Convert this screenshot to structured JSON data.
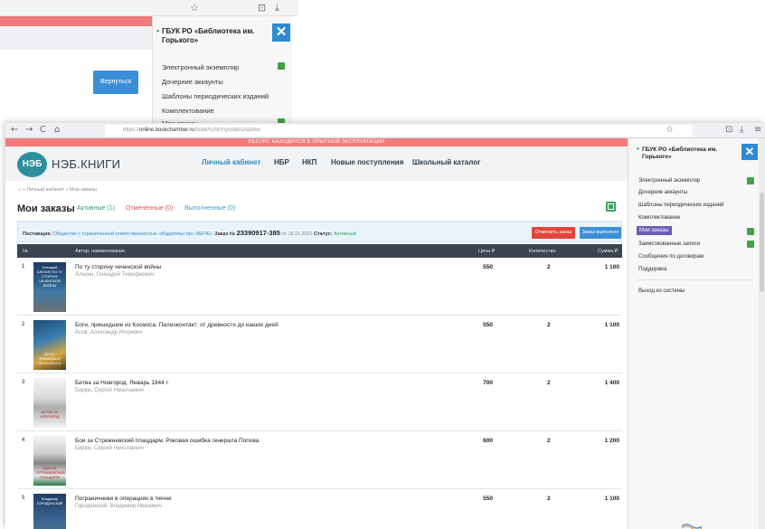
{
  "back": {
    "org": "ГБУК РО «Библиотека им. Горького»",
    "return_button": "Вернуться",
    "menu": [
      "Электронный экземпляр",
      "Дочерние аккаунты",
      "Шаблоны периодических изданий",
      "Комплектование",
      "Мои заказы"
    ],
    "close_glyph": "✕"
  },
  "browser": {
    "url_prefix": "https://",
    "url_host": "online.bookchamber.ru",
    "url_path": "/book/ru/lk/myorders#active",
    "back_glyph": "←",
    "forward_glyph": "→",
    "reload_glyph": "C",
    "home_glyph": "⌂",
    "star_glyph": "☆",
    "shield_glyph": "⊡",
    "download_glyph": "⤓",
    "menu_glyph": "≡"
  },
  "banner": "РЕСУРС НАХОДИТСЯ В ОПЫТНОЙ ЭКСПЛУАТАЦИИ",
  "header": {
    "logo": "НЭБ",
    "logo_text": "НЭБ.КНИГИ",
    "nav": [
      "Личный кабинет",
      "НБР",
      "НКП",
      "Новые поступления",
      "Школьный каталог"
    ]
  },
  "breadcrumb": {
    "home": "⌂",
    "sep": "»",
    "cabinet": "Личный кабинет",
    "orders": "Мои заказы"
  },
  "page": {
    "title": "Мои заказы",
    "tabs": [
      "Активные (1)",
      "Отменённые (0)",
      "Выполненные (0)"
    ]
  },
  "order": {
    "supplier_label": "Поставщик:",
    "supplier": "Общество с ограниченной ответственностью «Издательство «ВЕЧЕ»",
    "order_label": "Заказ №",
    "order_number": "23390917-385",
    "date_text": "от 18.11.2021",
    "status_label": "Статус:",
    "status": "Активный",
    "cancel_button": "Отменить заказ",
    "done_button": "Заказ выполнен"
  },
  "table": {
    "headers": [
      "№",
      "Автор, наименование",
      "Цена ₽",
      "Количество",
      "Сумма ₽"
    ],
    "rows": [
      {
        "n": "1",
        "title": "По ту сторону чеченской войны",
        "author": "Алехин, Геннадий Тимофеевич",
        "price": "550",
        "qty": "2",
        "sum": "1 100",
        "cover": "Геннадий АЛЕХИН ПО ТУ СТОРОНУ ЧЕЧЕНСКОЙ ВОЙНЫ"
      },
      {
        "n": "2",
        "title": "Боги, пришедшие из Космоса. Палеоконтакт: от древности до наших дней",
        "author": "Асов, Александр Игоревич",
        "price": "550",
        "qty": "2",
        "sum": "1 100",
        "cover": "БОГИ, ПРИШЕДШИЕ ИЗ КОСМОСА"
      },
      {
        "n": "3",
        "title": "Битва за Новгород. Январь 1944 г.",
        "author": "Бирюк, Сергей Николаевич",
        "price": "700",
        "qty": "2",
        "sum": "1 400",
        "cover": "БИТВА ЗА НОВГОРОД"
      },
      {
        "n": "4",
        "title": "Бои за Стрежневский плацдарм. Роковая ошибка генерала Попова",
        "author": "Бирюк, Сергей Николаевич",
        "price": "600",
        "qty": "2",
        "sum": "1 200",
        "cover": "БОИ ЗА СТРЕЖНЕВСКИЙ ПЛАЦДАРМ"
      },
      {
        "n": "5",
        "title": "Пограничники в операциях в Чечне",
        "author": "Городинский, Владимир Иванович",
        "price": "550",
        "qty": "2",
        "sum": "1 100",
        "cover": "Владимир ГОРОДИНСКИЙ"
      }
    ]
  },
  "side": {
    "org": "ГБУК РО «Библиотека им. Горького»",
    "close_glyph": "✕",
    "items": [
      "Электронный экземпляр",
      "Дочерние аккаунты",
      "Шаблоны периодических изданий",
      "Комплектование",
      "Мои заказы",
      "Заимствованные записи",
      "Сообщения по договорам",
      "Поддержка"
    ],
    "logout": "Выход из системы"
  }
}
